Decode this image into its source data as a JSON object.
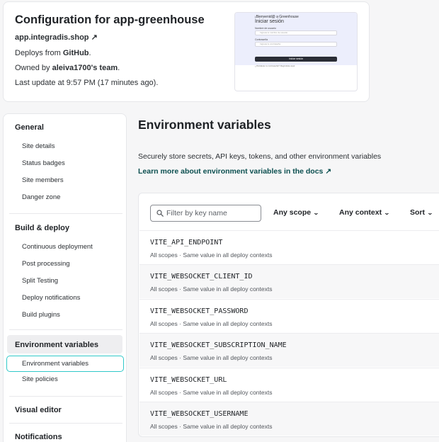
{
  "config": {
    "title": "Configuration for app-greenhouse",
    "site_url": "app.integradis.shop ↗",
    "deploys_prefix": "Deploys from ",
    "deploys_source": "GitHub",
    "deploys_suffix": ".",
    "owned_prefix": "Owned by ",
    "owned_team": "aleiva1700's team",
    "owned_suffix": ".",
    "last_update": "Last update at 9:57 PM (17 minutes ago)."
  },
  "preview": {
    "greeting": "¡Bienvenid@ a Greenhouse",
    "heading": "Iniciar sesión",
    "field1_label": "Nombre de usuario",
    "field1_placeholder": "Ingresa tu nombre de usuario",
    "field2_label": "Contraseña",
    "field2_placeholder": "Ingresa tu contraseña",
    "button": "Iniciar sesión",
    "footer": "¿Olvidaste tu contraseña? Regístrate aquí"
  },
  "sidebar": {
    "general": {
      "title": "General",
      "items": [
        "Site details",
        "Status badges",
        "Site members",
        "Danger zone"
      ]
    },
    "build": {
      "title": "Build & deploy",
      "items": [
        "Continuous deployment",
        "Post processing",
        "Split Testing",
        "Deploy notifications",
        "Build plugins"
      ]
    },
    "env": {
      "title": "Environment variables",
      "items": [
        "Environment variables",
        "Site policies"
      ]
    },
    "visual_editor": "Visual editor",
    "notifications": "Notifications"
  },
  "env": {
    "heading": "Environment variables",
    "description": "Securely store secrets, API keys, tokens, and other environment variables",
    "learn_more": "Learn more about environment variables in the docs ↗",
    "filter_placeholder": "Filter by key name",
    "filter_value": "",
    "scope_dropdown": "Any scope",
    "context_dropdown": "Any context",
    "sort_dropdown": "Sort",
    "variables": [
      {
        "name": "VITE_API_ENDPOINT",
        "scope": "All scopes",
        "contexts": "Same value in all deploy contexts"
      },
      {
        "name": "VITE_WEBSOCKET_CLIENT_ID",
        "scope": "All scopes",
        "contexts": "Same value in all deploy contexts"
      },
      {
        "name": "VITE_WEBSOCKET_PASSWORD",
        "scope": "All scopes",
        "contexts": "Same value in all deploy contexts"
      },
      {
        "name": "VITE_WEBSOCKET_SUBSCRIPTION_NAME",
        "scope": "All scopes",
        "contexts": "Same value in all deploy contexts"
      },
      {
        "name": "VITE_WEBSOCKET_URL",
        "scope": "All scopes",
        "contexts": "Same value in all deploy contexts"
      },
      {
        "name": "VITE_WEBSOCKET_USERNAME",
        "scope": "All scopes",
        "contexts": "Same value in all deploy contexts"
      }
    ]
  },
  "colors": {
    "accent_teal": "#30c8c9",
    "link_dark_teal": "#0b4f50",
    "text": "#1f2226",
    "preview_bg": "#eceefc"
  }
}
